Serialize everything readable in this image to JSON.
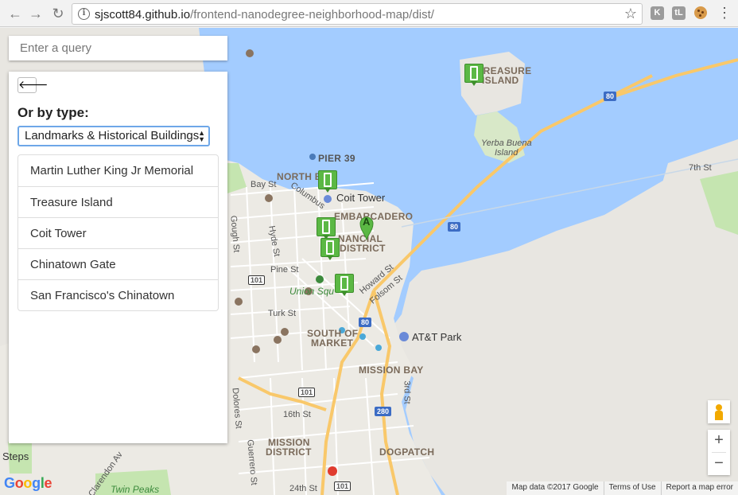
{
  "browser": {
    "url_host": "sjscott84.github.io",
    "url_path": "/frontend-nanodegree-neighborhood-map/dist/",
    "back_icon": "←",
    "forward_icon": "→",
    "reload_icon": "↻",
    "star_icon": "☆",
    "ext1": "K",
    "ext2": "tL",
    "menu_icon": "⋮"
  },
  "search": {
    "placeholder": "Enter a query"
  },
  "panel": {
    "back_label": "🡐",
    "type_label": "Or by type:",
    "selected_type": "Landmarks & Historical Buildings",
    "select_arrows": "▲▼",
    "results": [
      "Martin Luther King Jr Memorial",
      "Treasure Island",
      "Coit Tower",
      "Chinatown Gate",
      "San Francisco's Chinatown"
    ]
  },
  "map": {
    "labels": {
      "treasure_island_1": "TREASURE",
      "treasure_island_2": "ISLAND",
      "yerba_buena_1": "Yerba Buena",
      "yerba_buena_2": "Island",
      "pier39": "PIER 39",
      "north_beach": "NORTH BE",
      "coit": "Coit Tower",
      "embarcadero": "EMBARCADERO",
      "financial_1": "NANCIAL",
      "financial_2": "DISTRICT",
      "union_sq": "Union Squ",
      "south_market_1": "SOUTH OF",
      "south_market_2": "MARKET",
      "att_park": "AT&T Park",
      "mission_bay": "MISSION BAY",
      "mission_1": "MISSION",
      "mission_2": "DISTRICT",
      "dogpatch": "DOGPATCH",
      "twin_peaks": "Twin Peaks",
      "steps": "Steps",
      "bay_st": "Bay St",
      "pine_st": "Pine St",
      "turk_st": "Turk St",
      "seventh_st": "7th St",
      "sixteenth_st": "16th St",
      "twentyfourth_st": "24th St",
      "howard_st": "Howard St",
      "folsom_st": "Folsom St",
      "third_st": "3rd St",
      "hyde_st": "Hyde St",
      "gough_st": "Gough St",
      "columbus": "Columbus",
      "dolores_st": "Dolores St",
      "guerrero_st": "Guerrero St",
      "clarendon_av": "Clarendon Av"
    },
    "shields": [
      "80",
      "80",
      "80",
      "101",
      "101",
      "101",
      "280"
    ],
    "pin_label": "A",
    "zoom_in": "+",
    "zoom_out": "−",
    "google_letters": [
      "G",
      "o",
      "o",
      "g",
      "l",
      "e"
    ],
    "attribution": [
      "Map data ©2017 Google",
      "Terms of Use",
      "Report a map error"
    ]
  },
  "colors": {
    "water": "#a3ccff",
    "land": "#e8e6e1",
    "park": "#c5e5b0",
    "highway": "#f9c86a",
    "marker": "#5bb844",
    "select_focus": "#6ea7e8"
  }
}
